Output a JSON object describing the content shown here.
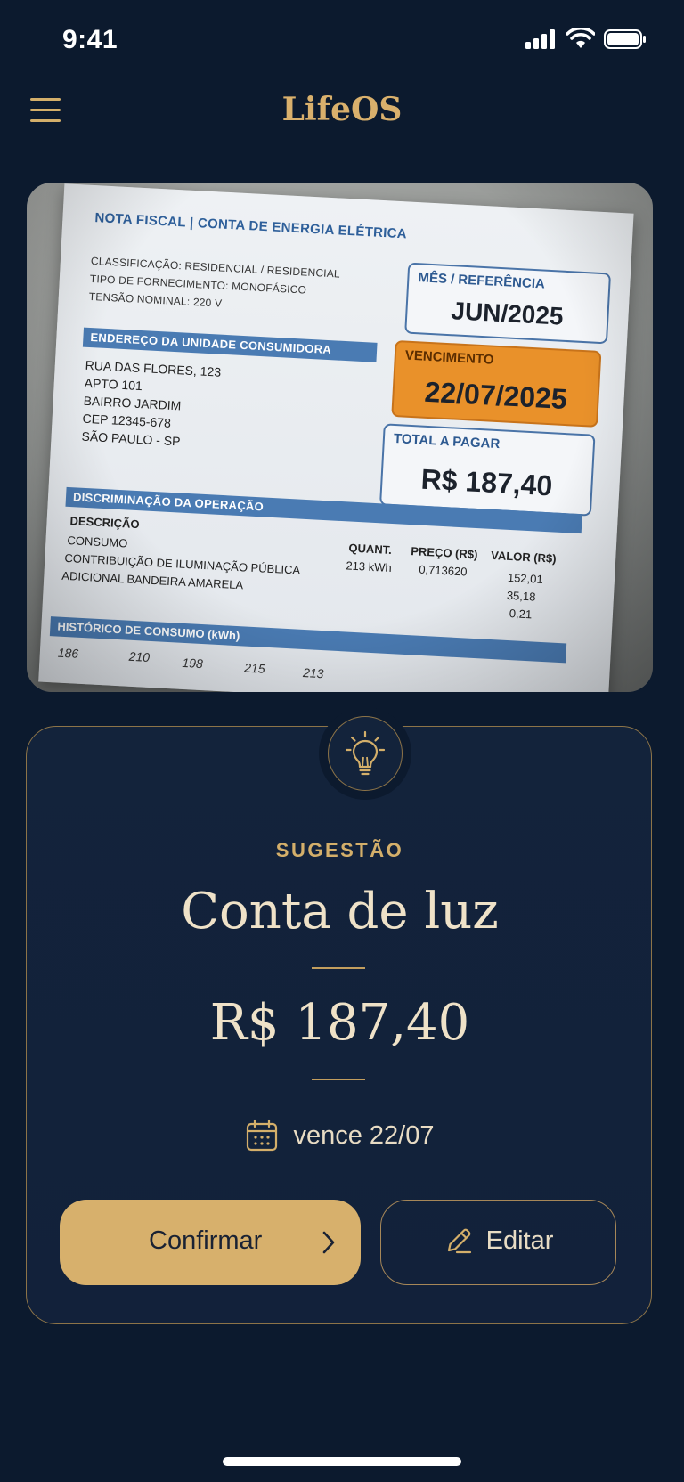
{
  "status_bar": {
    "time": "9:41"
  },
  "header": {
    "title": "LifeOS",
    "menu_icon": "hamburger-menu-icon"
  },
  "document_photo": {
    "heading": "NOTA FISCAL | CONTA DE ENERGIA ELÉTRICA",
    "info_lines": [
      "CLASSIFICAÇÃO: RESIDENCIAL / RESIDENCIAL",
      "TIPO DE FORNECIMENTO: MONOFÁSICO",
      "TENSÃO NOMINAL: 220 V"
    ],
    "address_heading": "ENDEREÇO DA UNIDADE CONSUMIDORA",
    "address_lines": [
      "RUA DAS FLORES, 123",
      "APTO 101",
      "BAIRRO JARDIM",
      "CEP 12345-678",
      "SÃO PAULO - SP"
    ],
    "ref_label": "MÊS / REFERÊNCIA",
    "ref_value": "JUN/2025",
    "due_label": "VENCIMENTO",
    "due_value": "22/07/2025",
    "total_label": "TOTAL A PAGAR",
    "total_value": "R$ 187,40",
    "operation_heading": "DISCRIMINAÇÃO DA OPERAÇÃO",
    "col_desc": "DESCRIÇÃO",
    "col_qty": "QUANT.",
    "col_price": "PREÇO (R$)",
    "col_value": "VALOR (R$)",
    "rows": [
      {
        "desc": "CONSUMO",
        "qty": "213 kWh",
        "price": "0,713620",
        "value": "152,01"
      },
      {
        "desc": "CONTRIBUIÇÃO DE ILUMINAÇÃO PÚBLICA",
        "qty": "",
        "price": "",
        "value": "35,18"
      },
      {
        "desc": "ADICIONAL BANDEIRA AMARELA",
        "qty": "",
        "price": "",
        "value": "0,21"
      }
    ],
    "history_heading": "HISTÓRICO DE CONSUMO (kWh)",
    "history_values": [
      "186",
      "210",
      "198",
      "215",
      "213"
    ]
  },
  "suggestion": {
    "icon": "lightbulb-icon",
    "label": "SUGESTÃO",
    "title": "Conta de luz",
    "amount": "R$ 187,40",
    "due_icon": "calendar-icon",
    "due_text": "vence 22/07",
    "confirm_label": "Confirmar",
    "edit_label": "Editar"
  },
  "colors": {
    "background": "#0c1a2e",
    "accent": "#d7b06c",
    "card": "#13233b"
  }
}
